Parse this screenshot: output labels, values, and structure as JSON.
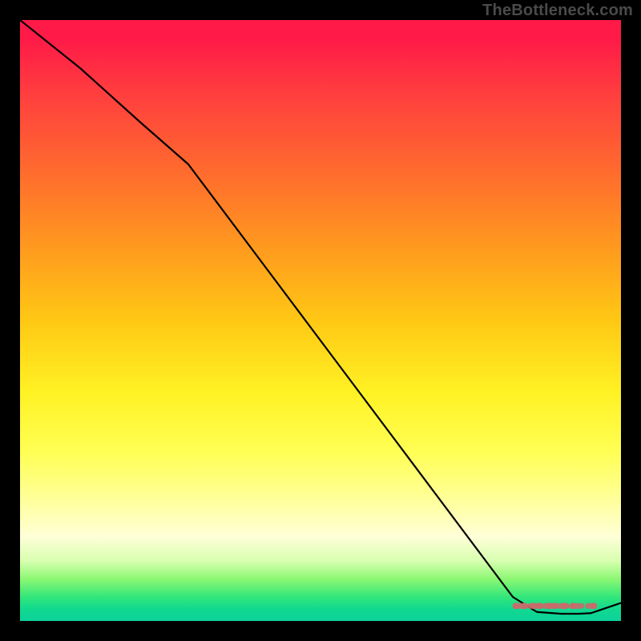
{
  "watermark": "TheBottleneck.com",
  "chart_data": {
    "type": "line",
    "title": "",
    "xlabel": "",
    "ylabel": "",
    "xlim": [
      0,
      100
    ],
    "ylim": [
      0,
      100
    ],
    "series": [
      {
        "name": "curve",
        "x": [
          0,
          10,
          20,
          28,
          40,
          55,
          70,
          82,
          86,
          90,
          93,
          95,
          100
        ],
        "y": [
          100,
          92,
          83,
          76,
          60,
          40,
          20,
          4,
          1.5,
          1.2,
          1.2,
          1.3,
          3
        ]
      }
    ],
    "flat_zone": {
      "x_start": 82,
      "x_end": 95,
      "y": 1.3
    },
    "marker_strip": {
      "y": 2.5,
      "points_x": [
        82.5,
        84,
        85.5,
        86.5,
        88,
        89,
        90.5,
        92,
        95.5
      ],
      "color": "#c96b6b",
      "radius": 4
    }
  }
}
